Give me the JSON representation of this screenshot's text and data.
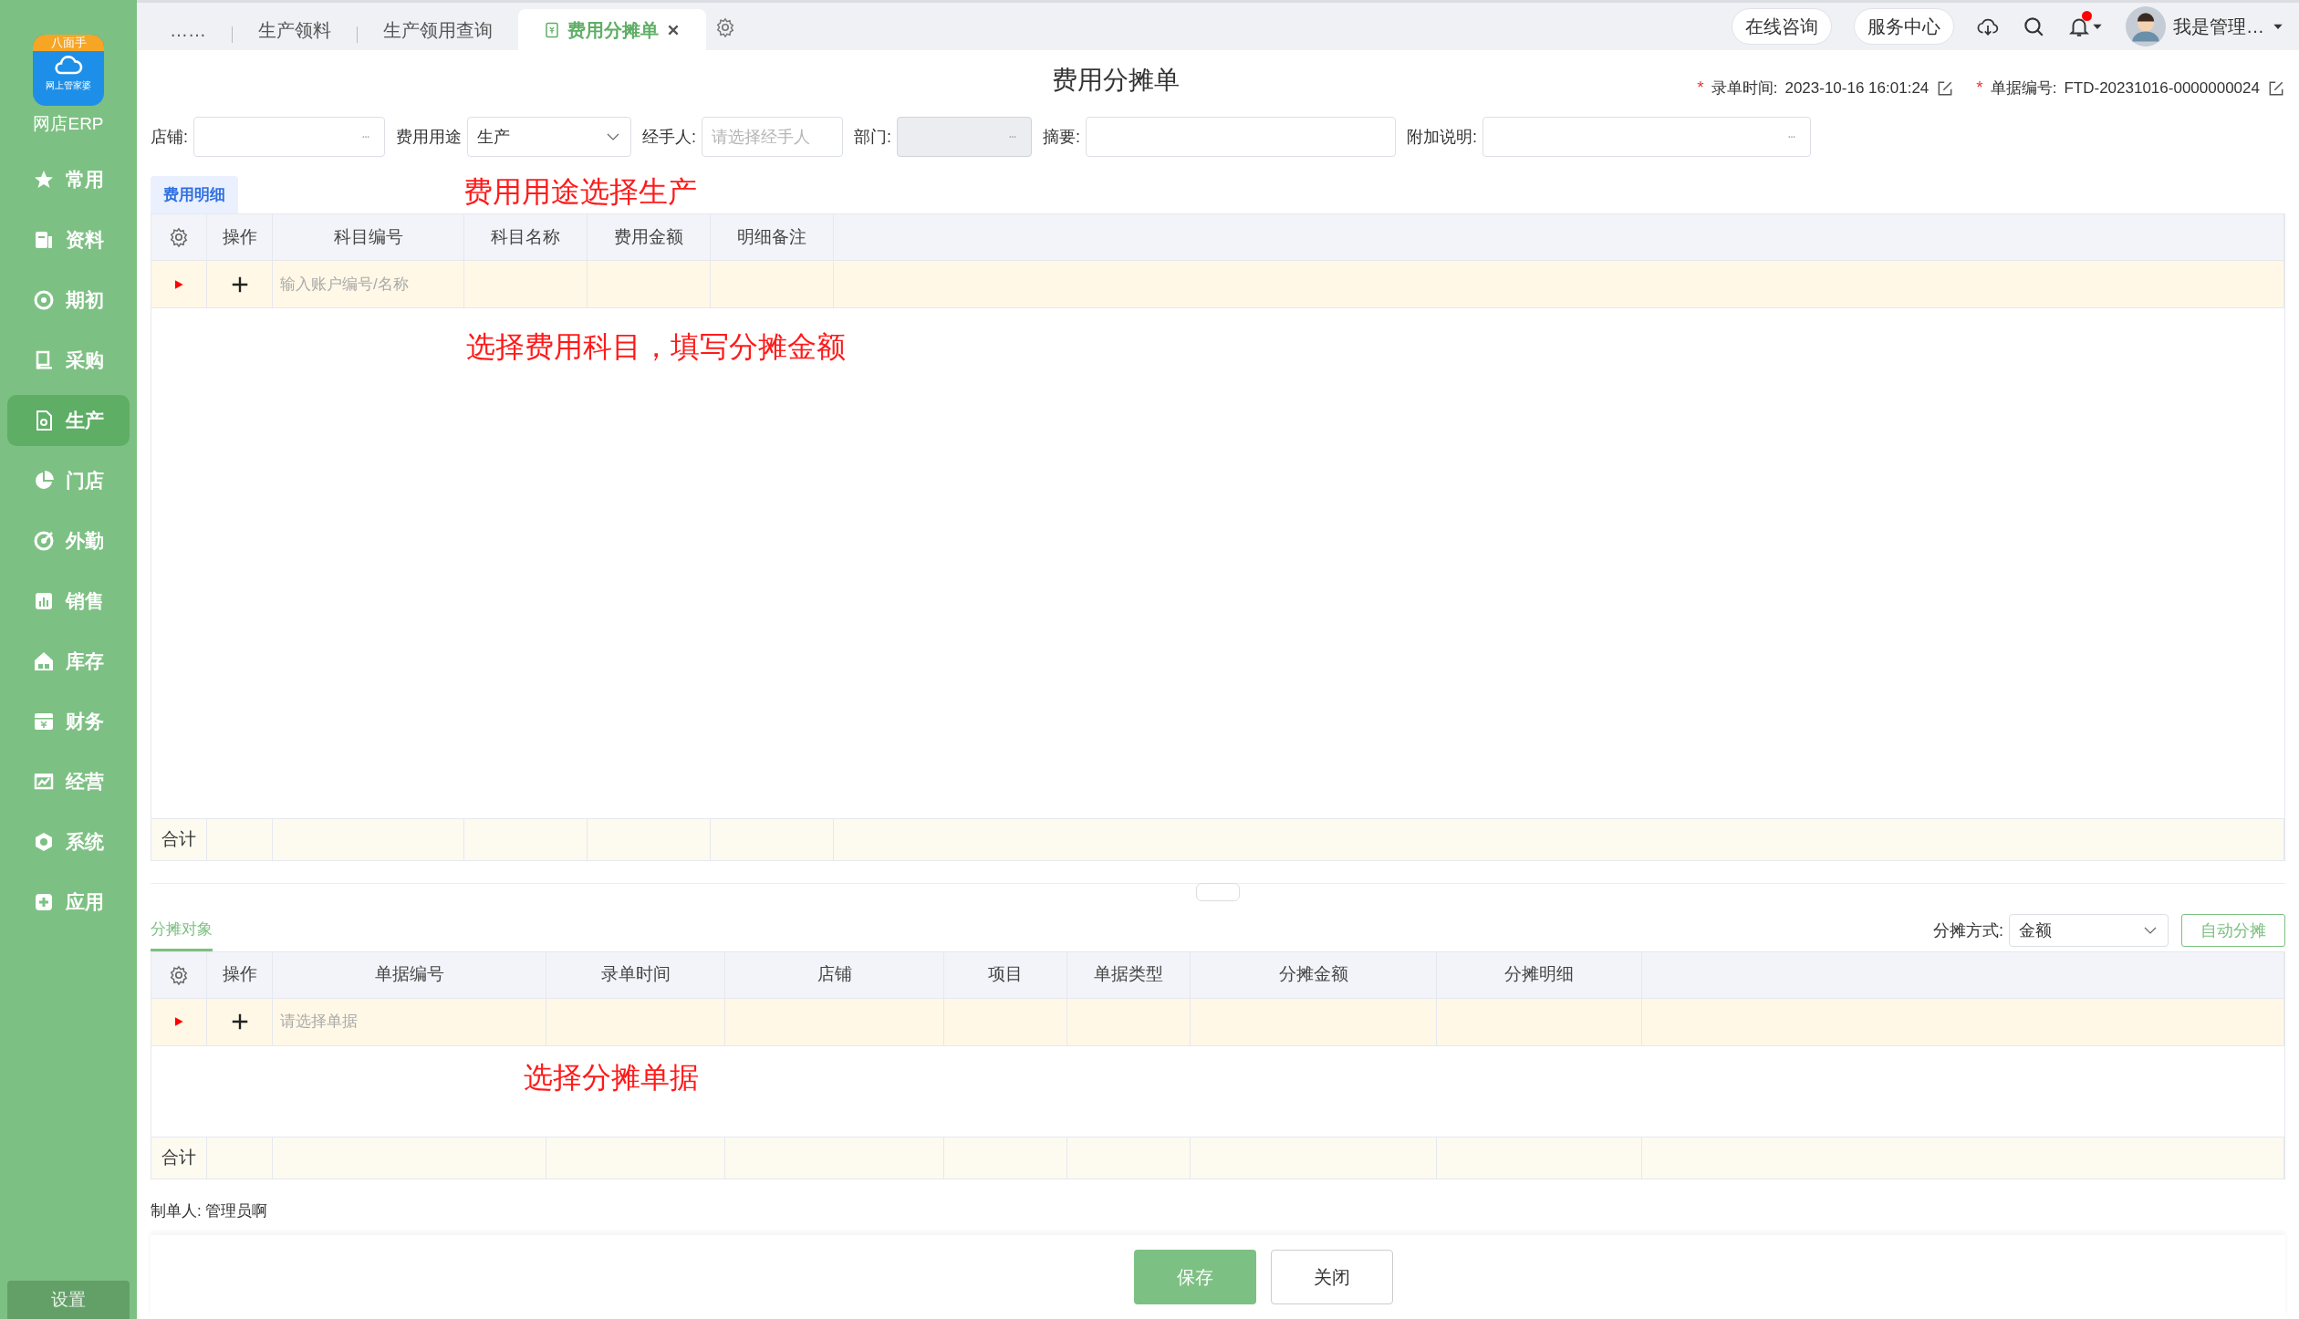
{
  "logo": {
    "badge": "八面手",
    "brand": "网上管家婆",
    "app_name": "网店ERP"
  },
  "sidebar": {
    "items": [
      {
        "label": "常用",
        "selected": false
      },
      {
        "label": "资料",
        "selected": false
      },
      {
        "label": "期初",
        "selected": false
      },
      {
        "label": "采购",
        "selected": false
      },
      {
        "label": "生产",
        "selected": true
      },
      {
        "label": "门店",
        "selected": false
      },
      {
        "label": "外勤",
        "selected": false
      },
      {
        "label": "销售",
        "selected": false
      },
      {
        "label": "库存",
        "selected": false
      },
      {
        "label": "财务",
        "selected": false
      },
      {
        "label": "经营",
        "selected": false
      },
      {
        "label": "系统",
        "selected": false
      },
      {
        "label": "应用",
        "selected": false
      }
    ],
    "settings": "设置"
  },
  "tabs": [
    {
      "label": "……",
      "selected": false
    },
    {
      "label": "生产领料",
      "selected": false
    },
    {
      "label": "生产领用查询",
      "selected": false
    },
    {
      "label": "费用分摊单",
      "selected": true
    }
  ],
  "header_actions": {
    "pills": [
      "在线咨询",
      "服务中心"
    ],
    "notification_dot": true,
    "user": "我是管理…"
  },
  "title": "费用分摊单",
  "meta": [
    {
      "label": "录单时间:",
      "value": "2023-10-16 16:01:24",
      "required_mark": "*"
    },
    {
      "label": "单据编号:",
      "value": "FTD-20231016-0000000024",
      "required_mark": "*"
    }
  ],
  "form": [
    {
      "label": "店铺:",
      "kind": "lookup",
      "disabled": false
    },
    {
      "label": "费用用途",
      "kind": "select",
      "value": "生产",
      "disabled": false
    },
    {
      "label": "经手人:",
      "kind": "input",
      "placeholder": "请选择经手人",
      "disabled": false
    },
    {
      "label": "部门:",
      "kind": "lookup",
      "disabled": true
    },
    {
      "label": "摘要:",
      "kind": "input",
      "disabled": false
    },
    {
      "label": "附加说明:",
      "kind": "lookup",
      "disabled": false
    }
  ],
  "detail": {
    "tab": {
      "label": "费用明细",
      "selected": true
    },
    "annotation": "费用用途选择生产",
    "columns": [
      "操作",
      "科目编号",
      "科目名称",
      "费用金额",
      "明细备注"
    ],
    "placeholder": "输入账户编号/名称",
    "body_annotation": "选择费用科目，填写分摊金额",
    "total_label": "合计"
  },
  "allocation": {
    "tab": {
      "label": "分摊对象",
      "selected": true
    },
    "method_label": "分摊方式:",
    "method_value": "金额",
    "auto_button": "自动分摊",
    "columns": [
      "操作",
      "单据编号",
      "录单时间",
      "店铺",
      "项目",
      "单据类型",
      "分摊金额",
      "分摊明细"
    ],
    "placeholder": "请选择单据",
    "body_annotation": "选择分摊单据",
    "total_label": "合计"
  },
  "creator": {
    "label": "制单人:",
    "value": "管理员啊"
  },
  "buttons": [
    "保存",
    "关闭"
  ]
}
